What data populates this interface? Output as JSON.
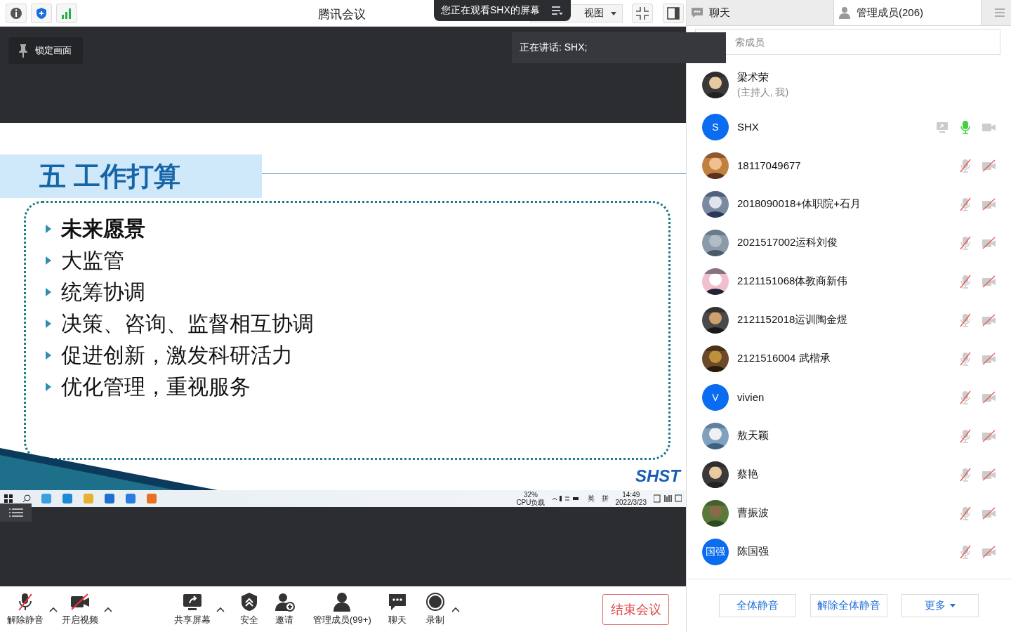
{
  "top_bar": {
    "title": "腾讯会议",
    "view_dropdown": "视图"
  },
  "banner": {
    "text": "您正在观看SHX的屏幕"
  },
  "lock_button": {
    "label": "锁定画面"
  },
  "speaking": {
    "text": "正在讲话: SHX;"
  },
  "slide": {
    "title": "五 工作打算",
    "bullets": [
      {
        "text": "未来愿景",
        "bold": true
      },
      {
        "text": "大监管",
        "bold": false
      },
      {
        "text": "统筹协调",
        "bold": false
      },
      {
        "text": "决策、咨询、监督相互协调",
        "bold": false
      },
      {
        "text": "促进创新，激发科研活力",
        "bold": false
      },
      {
        "text": "优化管理，重视服务",
        "bold": false
      }
    ],
    "logo": "SHST"
  },
  "taskbar": {
    "cpu_percent": "32%",
    "cpu_label": "CPU负载",
    "ime_lang": "英",
    "ime_mode": "拼",
    "time": "14:49",
    "date": "2022/3/23"
  },
  "toolbar": {
    "items": [
      {
        "kind": "mic",
        "label": "解除静音",
        "caret": true
      },
      {
        "kind": "video",
        "label": "开启视频",
        "caret": true
      },
      {
        "kind": "share",
        "label": "共享屏幕",
        "caret": true
      },
      {
        "kind": "security",
        "label": "安全",
        "caret": false
      },
      {
        "kind": "invite",
        "label": "邀请",
        "caret": false
      },
      {
        "kind": "members",
        "label": "管理成员(99+)",
        "caret": false
      },
      {
        "kind": "chat",
        "label": "聊天",
        "caret": false
      },
      {
        "kind": "record",
        "label": "录制",
        "caret": true
      }
    ],
    "end_button": "结束会议"
  },
  "panel": {
    "tabs": [
      {
        "kind": "chat",
        "label": "聊天",
        "selected": false
      },
      {
        "kind": "members",
        "label": "管理成员(206)",
        "selected": true
      }
    ],
    "search": {
      "placeholder": "索成员"
    },
    "members": [
      {
        "name": "梁术荣",
        "note": "(主持人, 我)",
        "controls": false
      },
      {
        "name": "SHX",
        "avatar": {
          "kind": "letter",
          "letter": "S"
        },
        "controls": true,
        "sharing": true,
        "mic_on": true,
        "camera_on": true
      },
      {
        "name": "18117049677",
        "controls": true,
        "sharing": false,
        "mic_on": false,
        "camera_on": false
      },
      {
        "name": "2018090018+体职院+石月",
        "controls": true,
        "sharing": false,
        "mic_on": false,
        "camera_on": false
      },
      {
        "name": "2021517002运科刘俊",
        "controls": true,
        "sharing": false,
        "mic_on": false,
        "camera_on": false
      },
      {
        "name": "2121151068体教商新伟",
        "controls": true,
        "sharing": false,
        "mic_on": false,
        "camera_on": false
      },
      {
        "name": "2121152018运训陶金煜",
        "controls": true,
        "sharing": false,
        "mic_on": false,
        "camera_on": false
      },
      {
        "name": "2121516004 武楷承",
        "controls": true,
        "sharing": false,
        "mic_on": false,
        "camera_on": false
      },
      {
        "name": "vivien",
        "avatar": {
          "kind": "letter",
          "letter": "V"
        },
        "controls": true,
        "sharing": false,
        "mic_on": false,
        "camera_on": false
      },
      {
        "name": "敖天颖",
        "controls": true,
        "sharing": false,
        "mic_on": false,
        "camera_on": false
      },
      {
        "name": "蔡艳",
        "controls": true,
        "sharing": false,
        "mic_on": false,
        "camera_on": false
      },
      {
        "name": "曹振波",
        "controls": true,
        "sharing": false,
        "mic_on": false,
        "camera_on": false
      },
      {
        "name": "陈国强",
        "avatar": {
          "kind": "letter",
          "letter": "国强"
        },
        "controls": true,
        "sharing": false,
        "mic_on": false,
        "camera_on": false
      }
    ],
    "footer_buttons": [
      {
        "label": "全体静音",
        "dropdown": false
      },
      {
        "label": "解除全体静音",
        "dropdown": false
      },
      {
        "label": "更多",
        "dropdown": true
      }
    ]
  }
}
